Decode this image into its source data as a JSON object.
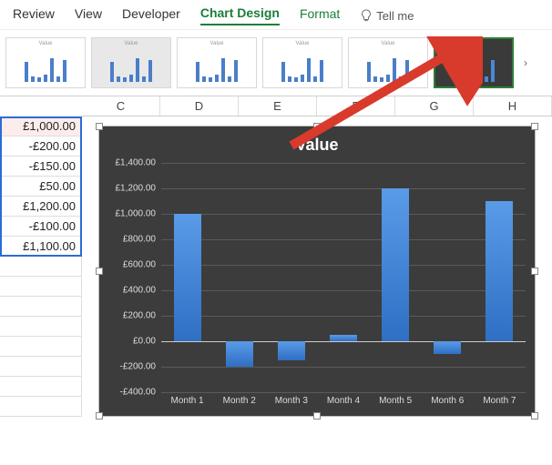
{
  "ribbon": {
    "tabs": [
      "Review",
      "View",
      "Developer",
      "Chart Design",
      "Format"
    ],
    "active": "Chart Design",
    "tellme": "Tell me"
  },
  "gallery": {
    "thumb_title": "Value",
    "selected_index": 5,
    "next_glyph": "›"
  },
  "columns": [
    "C",
    "D",
    "E",
    "F",
    "G",
    "H"
  ],
  "cells": [
    "£1,000.00",
    "-£200.00",
    "-£150.00",
    "£50.00",
    "£1,200.00",
    "-£100.00",
    "£1,100.00"
  ],
  "chart_data": {
    "type": "bar",
    "title": "Value",
    "categories": [
      "Month 1",
      "Month 2",
      "Month 3",
      "Month 4",
      "Month 5",
      "Month 6",
      "Month 7"
    ],
    "values": [
      1000,
      -200,
      -150,
      50,
      1200,
      -100,
      1100
    ],
    "ylim": [
      -400,
      1400
    ],
    "yticks": [
      "£1,400.00",
      "£1,200.00",
      "£1,000.00",
      "£800.00",
      "£600.00",
      "£400.00",
      "£200.00",
      "£0.00",
      "-£200.00",
      "-£400.00"
    ],
    "ytick_values": [
      1400,
      1200,
      1000,
      800,
      600,
      400,
      200,
      0,
      -200,
      -400
    ],
    "xlabel": "",
    "ylabel": ""
  }
}
